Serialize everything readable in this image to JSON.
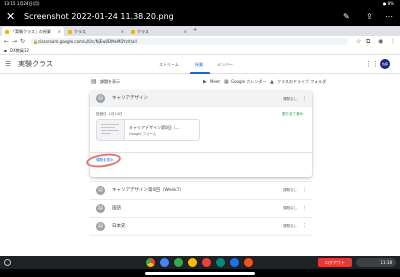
{
  "status": {
    "time": "13:15",
    "date": "1月24日(月)",
    "battery": "8%"
  },
  "viewer": {
    "title": "Screenshot 2022-01-24 11.38.20.png"
  },
  "browser": {
    "tabs": [
      {
        "label": "「実験クラス」の授業"
      },
      {
        "label": "クラス"
      },
      {
        "label": "クラス"
      }
    ],
    "url": "classroom.google.com/u/0/c/NjEw0DMxMDYz/t/all",
    "bookmark": "DX教員12"
  },
  "classroom": {
    "title": "実験クラス",
    "tabs": [
      "ストリーム",
      "授業",
      "メンバー"
    ],
    "avatar": "佐藤",
    "view_your_work": "課題を表示",
    "toolbar_links": [
      "Meet",
      "Google カレンダー",
      "クラスのドライブ フォルダ"
    ],
    "expanded": {
      "title": "キャリアデザイン",
      "status": "課題なし",
      "posted": "投稿日: 1月24日",
      "assigned": "割り当て済み",
      "attachment_title": "キャリアデザイン第0回（...",
      "attachment_type": "Google フォーム",
      "view_task": "課題を表示"
    },
    "rows": [
      {
        "title": "キャリアデザイン第0回（Week7）",
        "status": "課題なし"
      },
      {
        "title": "国語",
        "status": "課題なし"
      },
      {
        "title": "日本史",
        "status": "課題なし"
      }
    ]
  },
  "shelf": {
    "logout": "ログアウト",
    "time": "11:38"
  },
  "colors": {
    "accent": "#1967d2",
    "assigned": "#1e8e3e",
    "logout": "#e53935",
    "highlight": "#e57373"
  }
}
